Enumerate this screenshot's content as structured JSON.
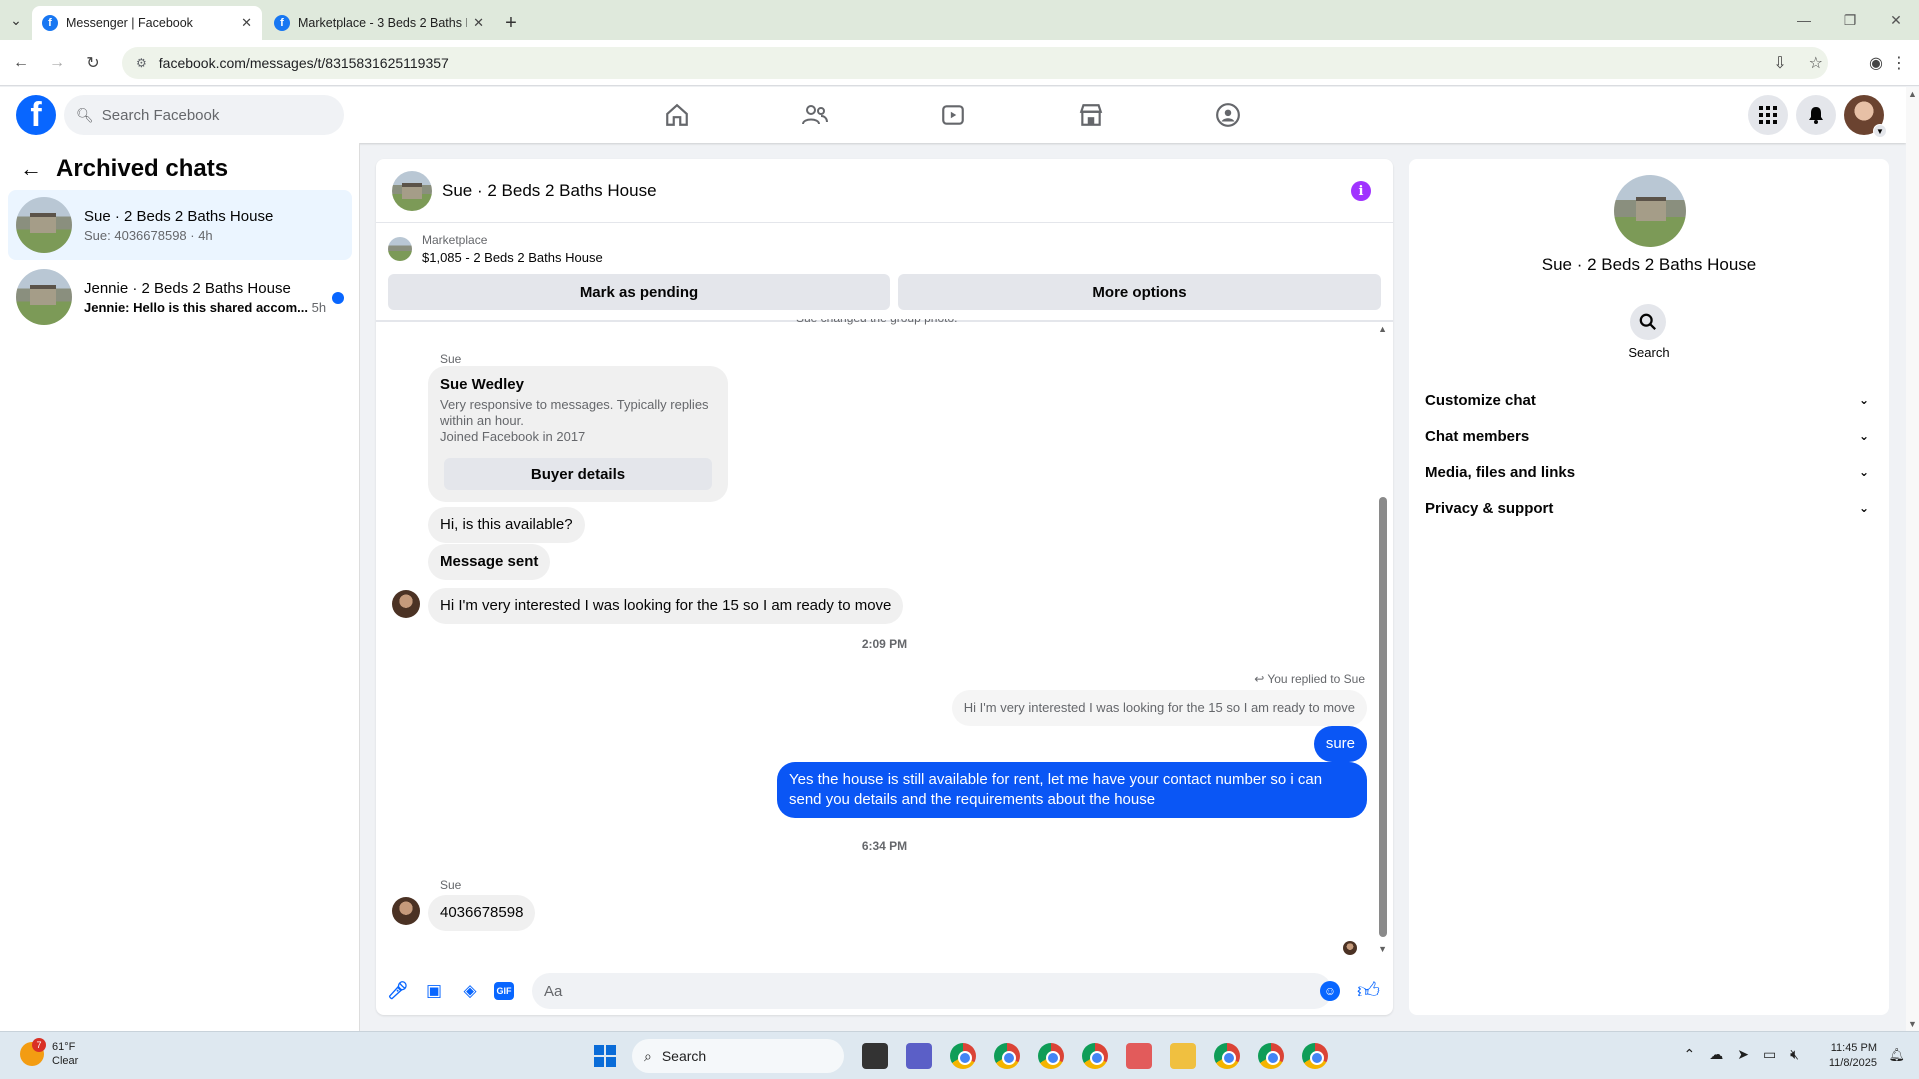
{
  "browser": {
    "tabs": [
      {
        "title": "Messenger | Facebook",
        "active": true
      },
      {
        "title": "Marketplace - 3 Beds 2 Baths H",
        "active": false
      }
    ],
    "url": "facebook.com/messages/t/8315831625119357"
  },
  "fb": {
    "search_placeholder": "Search Facebook",
    "colors": {
      "brand": "#0866ff",
      "out_bubble": "#0a56f5",
      "info": "#a033ff"
    }
  },
  "archived": {
    "title": "Archived chats",
    "chats": [
      {
        "name": "Sue · 2 Beds 2 Baths House",
        "preview": "Sue: 4036678598 · 4h",
        "time": "",
        "unread": false
      },
      {
        "name": "Jennie · 2 Beds 2 Baths House",
        "preview": "Jennie: Hello is this shared accom...",
        "time": "5h",
        "unread": true
      }
    ]
  },
  "conversation": {
    "title": "Sue · 2 Beds 2 Baths House",
    "marketplace_label": "Marketplace",
    "listing": "$1,085 - 2 Beds 2 Baths House",
    "mark_pending": "Mark as pending",
    "more_options": "More options",
    "system_partial": "Sue changed the group photo.",
    "sender1": "Sue",
    "card": {
      "name": "Sue Wedley",
      "desc": "Very responsive to messages. Typically replies within an hour.",
      "joined": "Joined Facebook in 2017",
      "button": "Buyer details"
    },
    "msg1": "Hi, is this available?",
    "msg2": "Message sent",
    "msg3": "Hi I'm very interested I was looking for the 15 so I am ready to move",
    "time1": "2:09 PM",
    "replied_label": "You replied to Sue",
    "reply_quote": "Hi I'm very interested I was looking for the 15 so I am ready to move",
    "out1": "sure",
    "out2": "Yes the house is still available for rent, let me have your contact number so i can send you details and the requirements about the house",
    "time2": "6:34 PM",
    "sender2": "Sue",
    "msg4": "4036678598",
    "composer_placeholder": "Aa"
  },
  "details": {
    "name": "Sue · 2 Beds 2 Baths House",
    "search_label": "Search",
    "sections": [
      "Customize chat",
      "Chat members",
      "Media, files and links",
      "Privacy & support"
    ]
  },
  "taskbar": {
    "temp": "61°F",
    "condition": "Clear",
    "weather_badge": "7",
    "search": "Search",
    "time": "11:45 PM",
    "date": "11/8/2025"
  }
}
